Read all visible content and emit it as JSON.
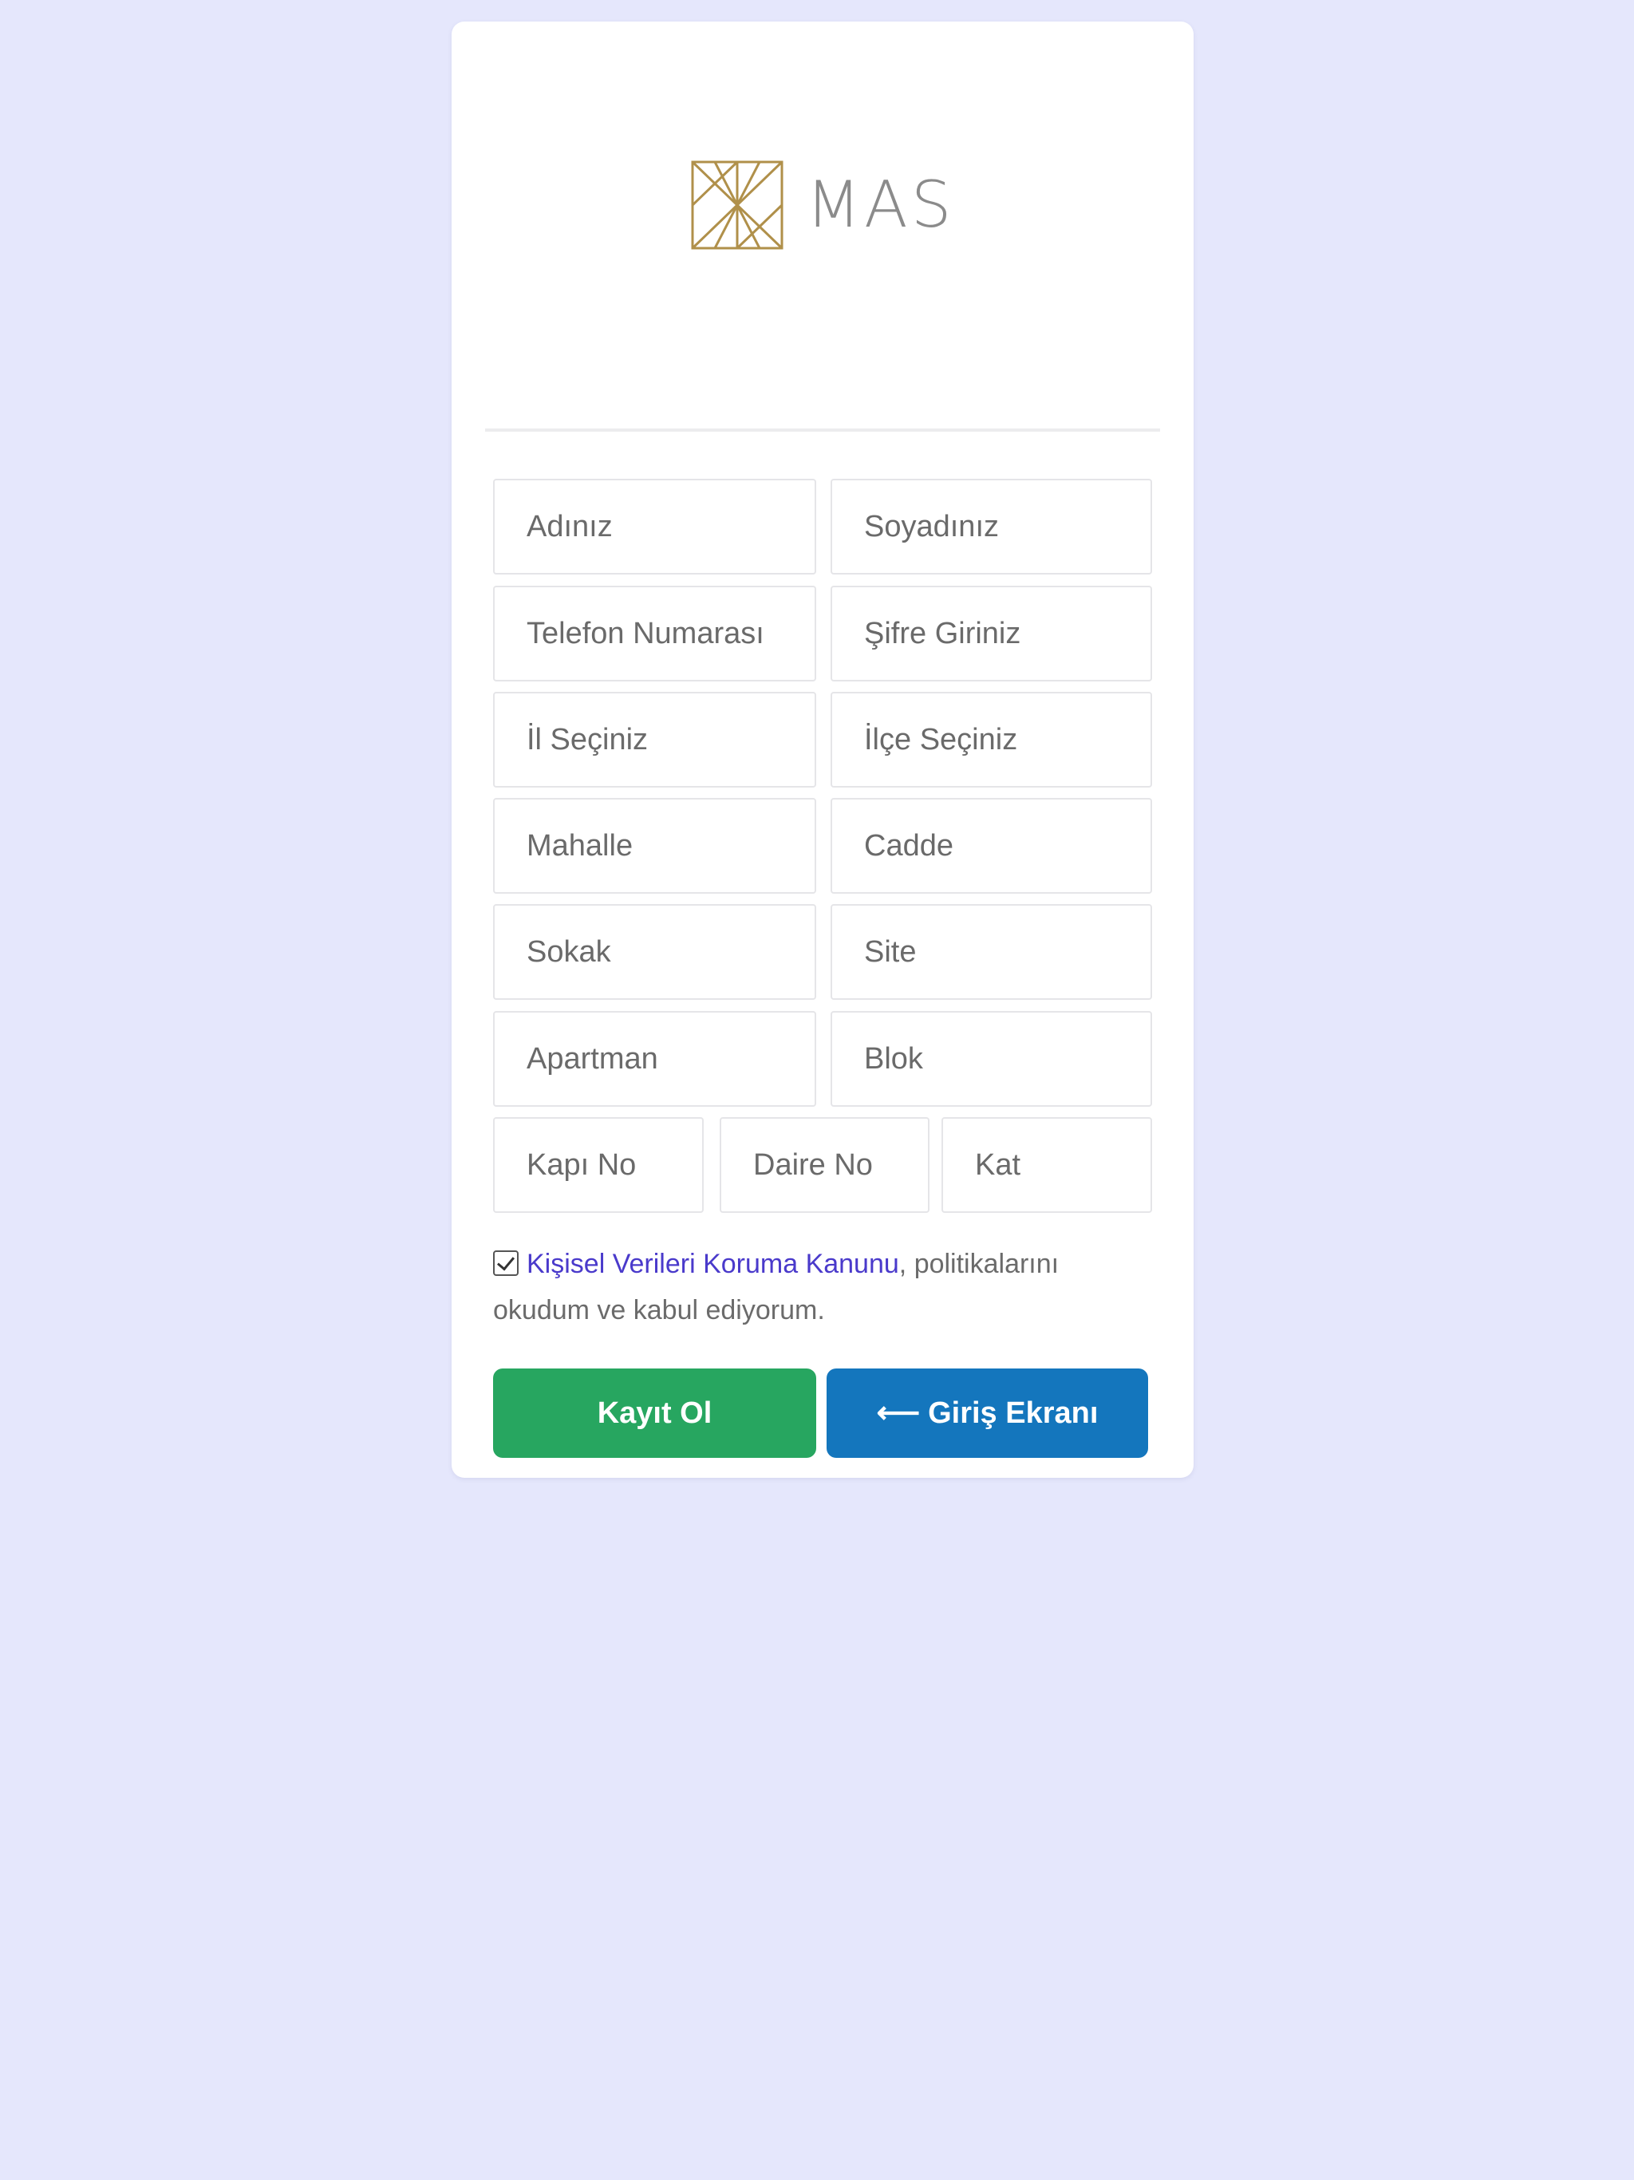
{
  "brand": {
    "name": "MAS",
    "mark_color": "#b0904a",
    "text_color": "#8b8b8b"
  },
  "form": {
    "first_name": {
      "placeholder": "Adınız",
      "value": ""
    },
    "last_name": {
      "placeholder": "Soyadınız",
      "value": ""
    },
    "phone": {
      "placeholder": "Telefon Numarası",
      "value": ""
    },
    "password": {
      "placeholder": "Şifre Giriniz",
      "value": ""
    },
    "province": {
      "placeholder": "İl Seçiniz",
      "value": ""
    },
    "district": {
      "placeholder": "İlçe Seçiniz",
      "value": ""
    },
    "neighborhood": {
      "placeholder": "Mahalle",
      "value": ""
    },
    "avenue": {
      "placeholder": "Cadde",
      "value": ""
    },
    "street": {
      "placeholder": "Sokak",
      "value": ""
    },
    "site": {
      "placeholder": "Site",
      "value": ""
    },
    "apartment": {
      "placeholder": "Apartman",
      "value": ""
    },
    "block": {
      "placeholder": "Blok",
      "value": ""
    },
    "door_no": {
      "placeholder": "Kapı No",
      "value": ""
    },
    "flat_no": {
      "placeholder": "Daire No",
      "value": ""
    },
    "floor": {
      "placeholder": "Kat",
      "value": ""
    }
  },
  "consent": {
    "checked": true,
    "link_text": "Kişisel Verileri Koruma Kanunu",
    "text": ", politikalarını okudum ve kabul ediyorum."
  },
  "buttons": {
    "register_label": "Kayıt Ol",
    "login_label": "Giriş Ekranı",
    "login_icon": "arrow-left-icon"
  },
  "colors": {
    "page_background": "#e5e7fc",
    "register_button": "#27a660",
    "login_button": "#1476bd",
    "link": "#4a3acb"
  }
}
